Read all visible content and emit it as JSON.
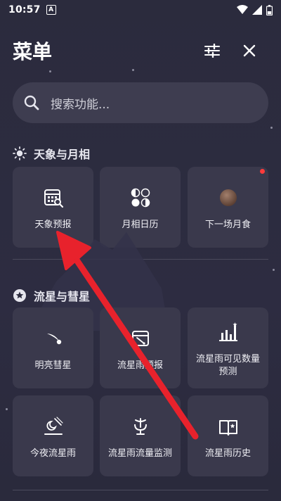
{
  "status": {
    "time": "10:57",
    "notif": "A"
  },
  "header": {
    "title": "菜单",
    "filter_icon": "sliders-icon",
    "close_icon": "close-icon"
  },
  "search": {
    "placeholder": "搜索功能..."
  },
  "sections": {
    "astro": {
      "title": "天象与月相",
      "items": [
        {
          "label": "天象预报",
          "icon": "calendar-search-icon"
        },
        {
          "label": "月相日历",
          "icon": "moon-phases-icon"
        },
        {
          "label": "下一场月食",
          "icon": "lunar-eclipse-icon"
        }
      ]
    },
    "meteor": {
      "title": "流星与彗星",
      "items": [
        {
          "label": "明亮彗星",
          "icon": "comet-icon"
        },
        {
          "label": "流星雨预报",
          "icon": "meteor-forecast-icon"
        },
        {
          "label": "流星雨可见数量预测",
          "icon": "bar-chart-icon"
        },
        {
          "label": "今夜流星雨",
          "icon": "meteor-tonight-icon"
        },
        {
          "label": "流星雨流量监测",
          "icon": "microphone-icon"
        },
        {
          "label": "流星雨历史",
          "icon": "book-star-icon"
        }
      ]
    }
  },
  "colors": {
    "background": "#2b2b3d",
    "card": "#3a394c",
    "search": "#3e3d50",
    "arrow": "#e8222c",
    "badge": "#ff3b3b"
  }
}
